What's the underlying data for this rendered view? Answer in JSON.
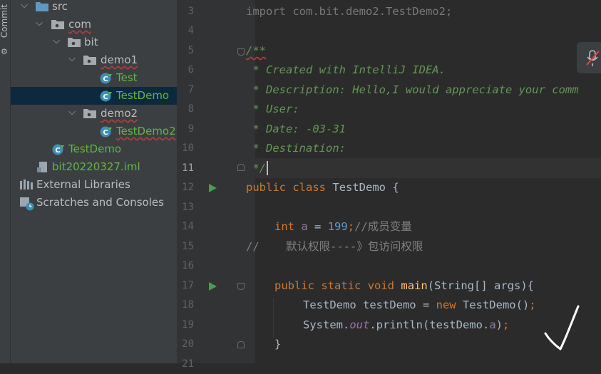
{
  "side_strip": {
    "label": "Commit"
  },
  "project_tree": [
    {
      "label": "src",
      "kind": "folder",
      "expanded": true
    },
    {
      "label": "com",
      "kind": "package",
      "expanded": true
    },
    {
      "label": "bit",
      "kind": "package",
      "expanded": true
    },
    {
      "label": "demo1",
      "kind": "package",
      "expanded": true
    },
    {
      "label": "Test",
      "kind": "class"
    },
    {
      "label": "TestDemo",
      "kind": "class",
      "selected": true
    },
    {
      "label": "demo2",
      "kind": "package",
      "expanded": true
    },
    {
      "label": "TestDemo2",
      "kind": "class"
    },
    {
      "label": "TestDemo",
      "kind": "class"
    },
    {
      "label": "bit20220327.iml",
      "kind": "module-file"
    },
    {
      "label": "External Libraries",
      "kind": "libraries"
    },
    {
      "label": "Scratches and Consoles",
      "kind": "scratches"
    }
  ],
  "editor": {
    "current_line": "11",
    "line_numbers": [
      "3",
      "4",
      "5",
      "6",
      "7",
      "8",
      "9",
      "10",
      "11",
      "12",
      "13",
      "14",
      "15",
      "16",
      "17",
      "18",
      "19",
      "20",
      "21"
    ],
    "code": {
      "l3_import": "import com.bit.demo2.TestDemo2;",
      "l5_start": "/**",
      "l6": " * Created with IntelliJ IDEA.",
      "l7": " * Description: Hello,I would appreciate your comm",
      "l8": " * User:",
      "l9": " * Date: -03-31",
      "l10": " * Destination:",
      "l11_end": " */",
      "l12_kw1": "public",
      "l12_kw2": "class",
      "l12_name": "TestDemo {",
      "l14_kw": "int",
      "l14_var": "a",
      "l14_eq": " = ",
      "l14_num": "199",
      "l14_semi": ";",
      "l14_cmt": "//成员变量",
      "l15_cmt": "//    默认权限----》包访问权限",
      "l17_kw1": "public",
      "l17_kw2": "static",
      "l17_kw3": "void",
      "l17_fn": "main",
      "l17_rest": "(String[] args){",
      "l18_a": "TestDemo testDemo = ",
      "l18_kw": "new",
      "l18_b": " TestDemo()",
      "l18_semi": ";",
      "l19_a": "System.",
      "l19_out": "out",
      "l19_b": ".println(testDemo.",
      "l19_fld": "a",
      "l19_c": ")",
      "l19_semi": ";",
      "l20": "}"
    }
  },
  "colors": {
    "keyword": "#cc7832",
    "doc_comment": "#629755",
    "number": "#6897bb",
    "field": "#9876aa",
    "method": "#ffc66d",
    "tree_class": "#62b543",
    "run_gutter": "#499c54"
  },
  "icons": [
    "folder-icon",
    "package-icon",
    "class-icon",
    "module-file-icon",
    "libraries-icon",
    "scratches-icon",
    "run-gutter-icon",
    "fold-marker-icon",
    "mic-muted-icon",
    "checkmark-annotation"
  ]
}
